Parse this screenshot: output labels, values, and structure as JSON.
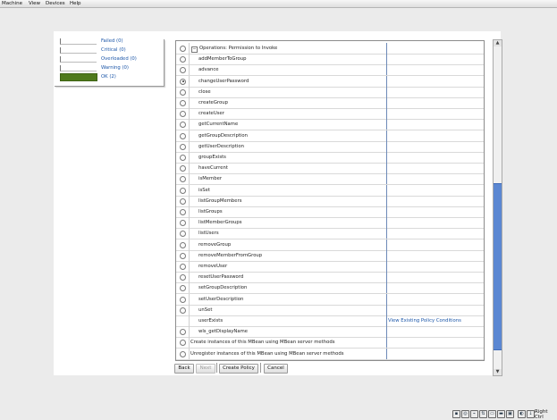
{
  "menubar": {
    "items": [
      "Machine",
      "View",
      "Devices",
      "Help"
    ]
  },
  "legend": {
    "items": [
      {
        "label": "Failed (0)",
        "color": "#ffffff"
      },
      {
        "label": "Critical (0)",
        "color": "#ffffff"
      },
      {
        "label": "Overloaded (0)",
        "color": "#ffffff"
      },
      {
        "label": "Warning (0)",
        "color": "#ffffff"
      },
      {
        "label": "OK (2)",
        "color": "#4f7a1c"
      }
    ]
  },
  "table": {
    "header": {
      "expander": "−",
      "label": "Operations: Permission to Invoke"
    },
    "operations": [
      {
        "name": "addMemberToGroup",
        "selected": false,
        "radio": true,
        "condition": ""
      },
      {
        "name": "advance",
        "selected": false,
        "radio": true,
        "condition": ""
      },
      {
        "name": "changeUserPassword",
        "selected": true,
        "radio": true,
        "condition": ""
      },
      {
        "name": "close",
        "selected": false,
        "radio": true,
        "condition": ""
      },
      {
        "name": "createGroup",
        "selected": false,
        "radio": true,
        "condition": ""
      },
      {
        "name": "createUser",
        "selected": false,
        "radio": true,
        "condition": ""
      },
      {
        "name": "getCurrentName",
        "selected": false,
        "radio": true,
        "condition": ""
      },
      {
        "name": "getGroupDescription",
        "selected": false,
        "radio": true,
        "condition": ""
      },
      {
        "name": "getUserDescription",
        "selected": false,
        "radio": true,
        "condition": ""
      },
      {
        "name": "groupExists",
        "selected": false,
        "radio": true,
        "condition": ""
      },
      {
        "name": "haveCurrent",
        "selected": false,
        "radio": true,
        "condition": ""
      },
      {
        "name": "isMember",
        "selected": false,
        "radio": true,
        "condition": ""
      },
      {
        "name": "isSet",
        "selected": false,
        "radio": true,
        "condition": ""
      },
      {
        "name": "listGroupMembers",
        "selected": false,
        "radio": true,
        "condition": ""
      },
      {
        "name": "listGroups",
        "selected": false,
        "radio": true,
        "condition": ""
      },
      {
        "name": "listMemberGroups",
        "selected": false,
        "radio": true,
        "condition": ""
      },
      {
        "name": "listUsers",
        "selected": false,
        "radio": true,
        "condition": ""
      },
      {
        "name": "removeGroup",
        "selected": false,
        "radio": true,
        "condition": ""
      },
      {
        "name": "removeMemberFromGroup",
        "selected": false,
        "radio": true,
        "condition": ""
      },
      {
        "name": "removeUser",
        "selected": false,
        "radio": true,
        "condition": ""
      },
      {
        "name": "resetUserPassword",
        "selected": false,
        "radio": true,
        "condition": ""
      },
      {
        "name": "setGroupDescription",
        "selected": false,
        "radio": true,
        "condition": ""
      },
      {
        "name": "setUserDescription",
        "selected": false,
        "radio": true,
        "condition": ""
      },
      {
        "name": "unSet",
        "selected": false,
        "radio": true,
        "condition": ""
      },
      {
        "name": "userExists",
        "selected": false,
        "radio": false,
        "condition": "View Existing Policy Conditions"
      },
      {
        "name": "wls_getDisplayName",
        "selected": false,
        "radio": true,
        "condition": ""
      }
    ],
    "extra_rows": [
      {
        "label": "Create instances of this MBean using MBean server methods",
        "selected": false
      },
      {
        "label": "Unregister instances of this MBean using MBean server methods",
        "selected": false
      }
    ]
  },
  "buttons": {
    "back": "Back",
    "next": "Next",
    "create_policy": "Create Policy",
    "cancel": "Cancel"
  },
  "scrollbar": {
    "up": "▲",
    "down": "▼"
  },
  "statusbar": {
    "host_key": "Right Ctrl"
  },
  "colors": {
    "link": "#1a55a8",
    "scroll_thumb": "#5b87d2",
    "ok_swatch": "#4f7a1c"
  }
}
